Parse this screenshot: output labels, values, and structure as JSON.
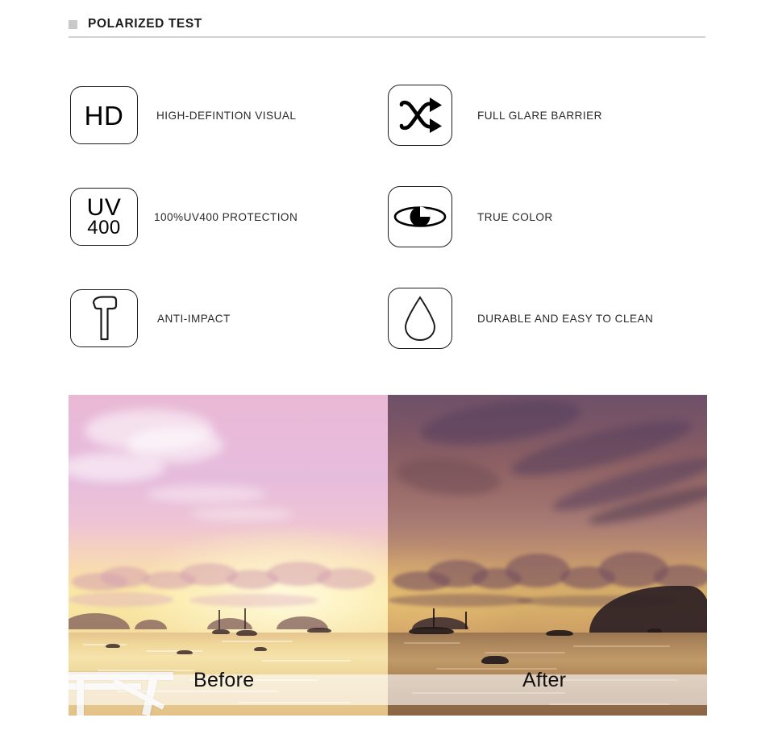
{
  "header": {
    "title": "POLARIZED TEST",
    "bullet_color": "#c9c9c9",
    "rule_color": "#d2d2d2"
  },
  "features": [
    {
      "icon_name": "hd-badge-icon",
      "icon_text": "HD",
      "label": "HIGH-DEFINTION VISUAL"
    },
    {
      "icon_name": "shuffle-arrows-icon",
      "icon_text": "",
      "label": "FULL GLARE BARRIER"
    },
    {
      "icon_name": "uv400-badge-icon",
      "icon_text_top": "UV",
      "icon_text_bottom": "400",
      "label": "100%UV400 PROTECTION"
    },
    {
      "icon_name": "eye-icon",
      "icon_text": "",
      "label": "TRUE COLOR"
    },
    {
      "icon_name": "hammer-icon",
      "icon_text": "",
      "label": "ANTI-IMPACT"
    },
    {
      "icon_name": "water-drop-icon",
      "icon_text": "",
      "label": "DURABLE AND EASY TO CLEAN"
    }
  ],
  "comparison": {
    "before_label": "Before",
    "after_label": "After",
    "scene": "sunset seascape with islands and boats"
  }
}
